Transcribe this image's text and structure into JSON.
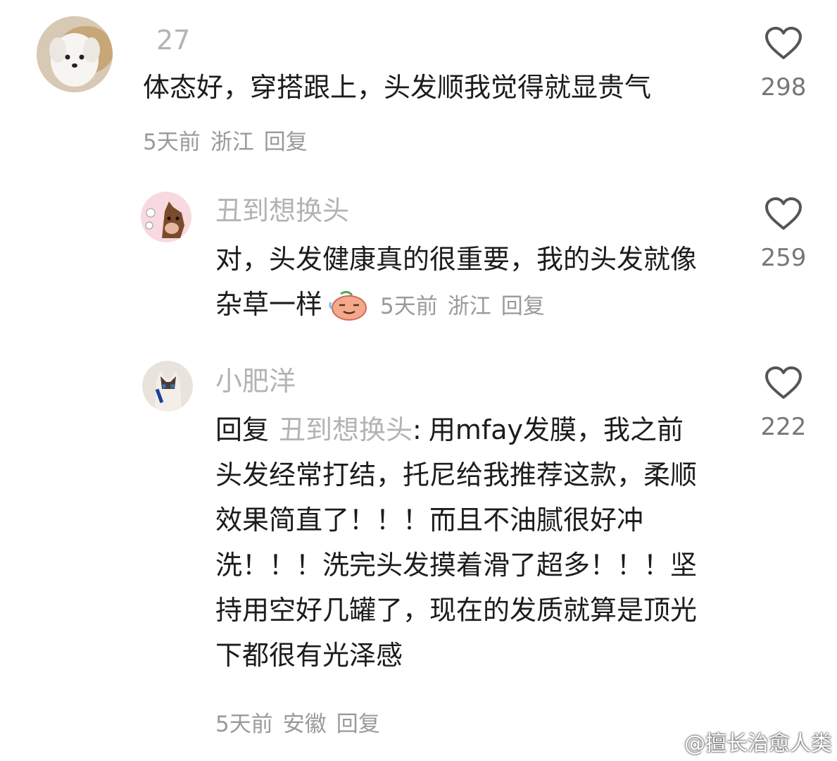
{
  "comments": [
    {
      "username": "27",
      "text": "体态好，穿搭跟上，头发顺我觉得就显贵气",
      "time": "5天前",
      "location": "浙江",
      "reply_label": "回复",
      "likes": "298",
      "avatar_icon": "white-dog-avatar"
    },
    {
      "username": "丑到想换头",
      "text": "对，头发健康真的很重要，我的头发就像杂草一样",
      "time": "5天前",
      "location": "浙江",
      "reply_label": "回复",
      "likes": "259",
      "avatar_icon": "horse-cartoon-avatar",
      "emoji_icon": "sweating-face-emoji"
    },
    {
      "username": "小肥洋",
      "reply_prefix": "回复",
      "reply_target": "丑到想换头",
      "reply_colon": ":",
      "text": "用mfay发膜，我之前头发经常打结，托尼给我推荐这款，柔顺效果简直了！！！而且不油腻很好冲洗！！！洗完头发摸着滑了超多！！！坚持用空好几罐了，现在的发质就算是顶光下都很有光泽感",
      "time": "5天前",
      "location": "安徽",
      "reply_label": "回复",
      "likes": "222",
      "avatar_icon": "ragdoll-cat-avatar"
    }
  ],
  "watermark": "@擅长治愈人类",
  "colors": {
    "username": "#b3b3b3",
    "text": "#1c1c1c",
    "meta": "#9a9a9a",
    "heart": "#555555"
  }
}
